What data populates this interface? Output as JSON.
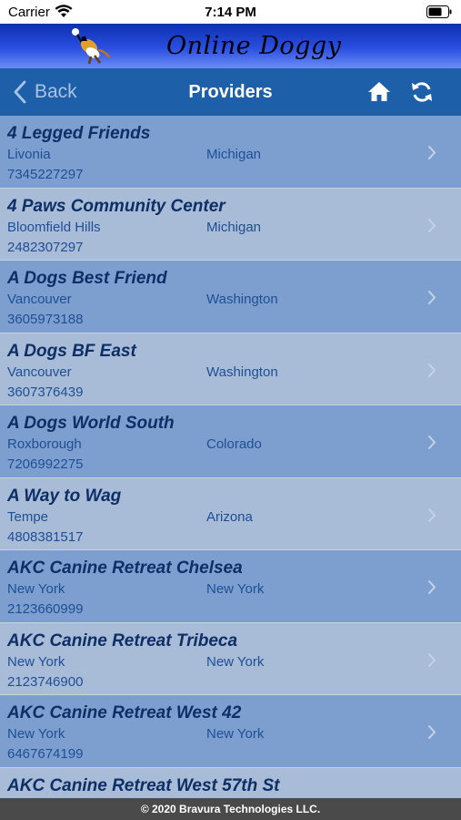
{
  "status_bar": {
    "carrier": "Carrier",
    "time": "7:14 PM"
  },
  "brand": {
    "title": "Online Doggy",
    "logo_icon": "dog-logo-icon"
  },
  "nav": {
    "back_label": "Back",
    "title": "Providers",
    "home_icon": "home-icon",
    "refresh_icon": "refresh-icon"
  },
  "providers": [
    {
      "name": "4 Legged Friends",
      "city": "Livonia",
      "state": "Michigan",
      "phone": "7345227297"
    },
    {
      "name": "4 Paws Community Center",
      "city": "Bloomfield Hills",
      "state": "Michigan",
      "phone": "2482307297"
    },
    {
      "name": "A Dogs Best Friend",
      "city": "Vancouver",
      "state": "Washington",
      "phone": "3605973188"
    },
    {
      "name": "A Dogs BF East",
      "city": "Vancouver",
      "state": "Washington",
      "phone": "3607376439"
    },
    {
      "name": "A Dogs World South",
      "city": "Roxborough",
      "state": "Colorado",
      "phone": "7206992275"
    },
    {
      "name": "A Way to Wag",
      "city": "Tempe",
      "state": "Arizona",
      "phone": "4808381517"
    },
    {
      "name": "AKC Canine Retreat Chelsea",
      "city": "New York",
      "state": "New York",
      "phone": "2123660999"
    },
    {
      "name": "AKC Canine Retreat Tribeca",
      "city": "New York",
      "state": "New York",
      "phone": "2123746900"
    },
    {
      "name": "AKC Canine Retreat West 42",
      "city": "New York",
      "state": "New York",
      "phone": "6467674199"
    },
    {
      "name": "AKC Canine Retreat West 57th St",
      "city": "",
      "state": "",
      "phone": ""
    }
  ],
  "footer": {
    "copyright": "© 2020 Bravura Technologies LLC."
  },
  "colors": {
    "nav_bar": "#1d5fa8",
    "row_dark": "#7d9fcf",
    "row_light": "#a8bbd7",
    "name_text": "#0d2f66",
    "detail_text": "#1e4f95",
    "footer": "#4a4a4a"
  }
}
